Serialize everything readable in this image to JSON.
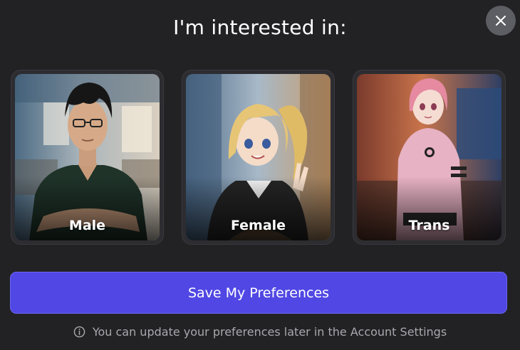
{
  "title": "I'm interested in:",
  "close_icon": "close-icon",
  "options": [
    {
      "label": "Male"
    },
    {
      "label": "Female"
    },
    {
      "label": "Trans"
    }
  ],
  "save_button": {
    "label": "Save My Preferences"
  },
  "hint": {
    "icon": "info-icon",
    "text": "You can update your preferences later in the Account Settings"
  },
  "colors": {
    "background": "#222225",
    "card_border": "#3a3a3f",
    "accent": "#5047e4",
    "hint_text": "#a8a8ae"
  }
}
